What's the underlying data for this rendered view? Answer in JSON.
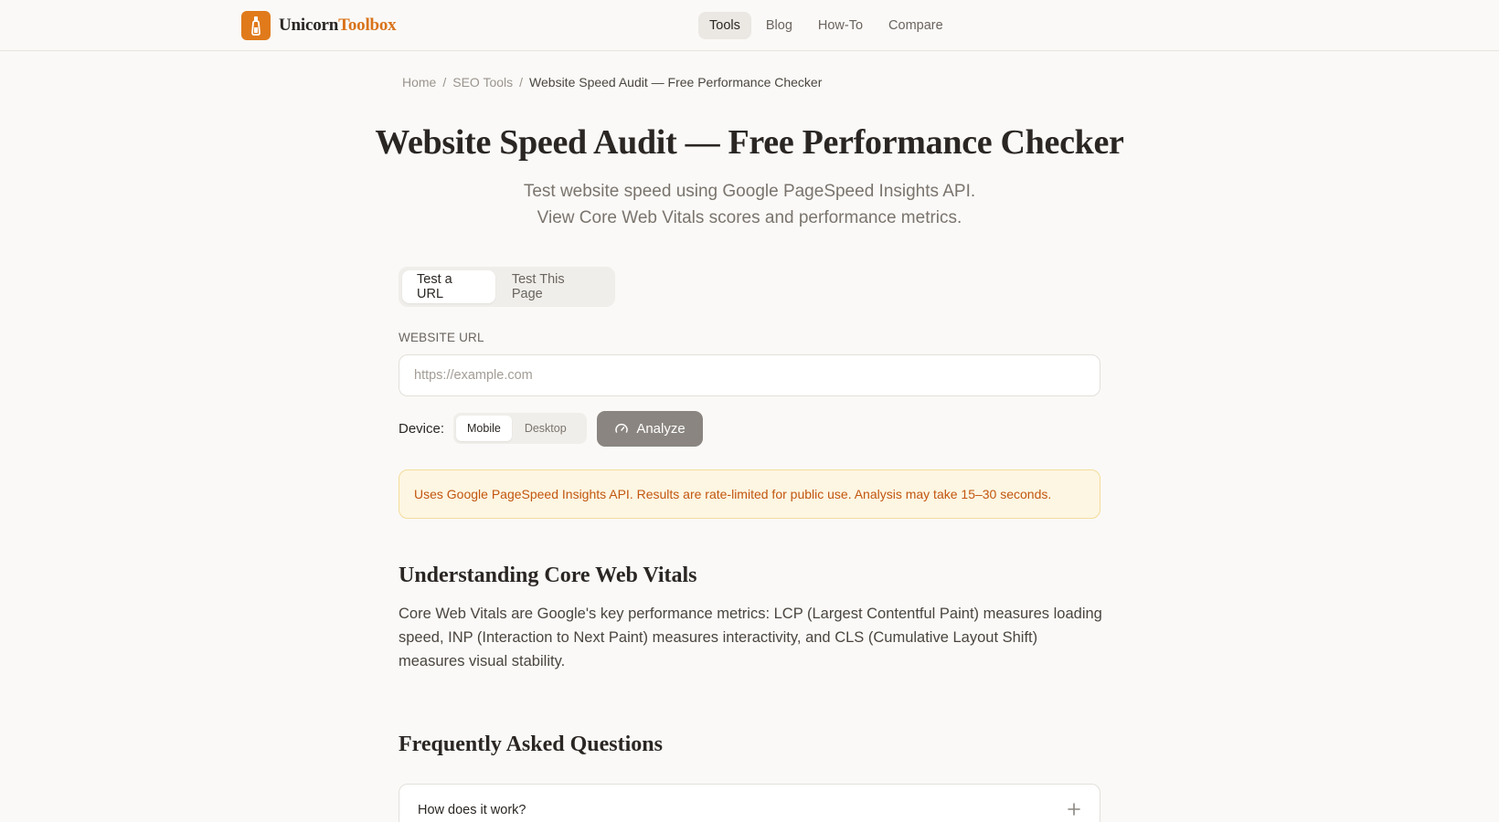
{
  "brand": {
    "name_part1": "Unicorn",
    "name_part2": "Toolbox",
    "accent": "#e07a1b"
  },
  "nav": {
    "items": [
      {
        "label": "Tools",
        "active": true
      },
      {
        "label": "Blog"
      },
      {
        "label": "How-To"
      },
      {
        "label": "Compare"
      }
    ]
  },
  "breadcrumb": {
    "home": "Home",
    "sep": "/",
    "section": "SEO Tools",
    "current": "Website Speed Audit — Free Performance Checker"
  },
  "page": {
    "title": "Website Speed Audit — Free Performance Checker",
    "subtitle_line1": "Test website speed using Google PageSpeed Insights API.",
    "subtitle_line2": "View Core Web Vitals scores and performance metrics."
  },
  "tabs": [
    {
      "label": "Test a URL",
      "active": true
    },
    {
      "label": "Test This Page"
    }
  ],
  "form": {
    "url_label": "WEBSITE URL",
    "url_placeholder": "https://example.com",
    "url_value": "",
    "device_label": "Device:",
    "device_options": [
      {
        "label": "Mobile",
        "active": true
      },
      {
        "label": "Desktop"
      }
    ],
    "analyze_label": "Analyze",
    "analyze_icon": "gauge-icon"
  },
  "notice": {
    "text": "Uses Google PageSpeed Insights API. Results are rate-limited for public use. Analysis may take 15–30 seconds."
  },
  "cwv": {
    "title": "Understanding Core Web Vitals",
    "body": "Core Web Vitals are Google's key performance metrics: LCP (Largest Contentful Paint) measures loading speed, INP (Interaction to Next Paint) measures interactivity, and CLS (Cumulative Layout Shift) measures visual stability."
  },
  "faq": {
    "title": "Frequently Asked Questions",
    "items": [
      {
        "question": "How does it work?",
        "icon": "plus-icon"
      }
    ]
  },
  "colors": {
    "background": "#faf9f7",
    "brand_orange": "#d9731a",
    "analyze_button": "#8a8580",
    "notice_bg": "#fdf6e2",
    "notice_text": "#c2560f"
  }
}
